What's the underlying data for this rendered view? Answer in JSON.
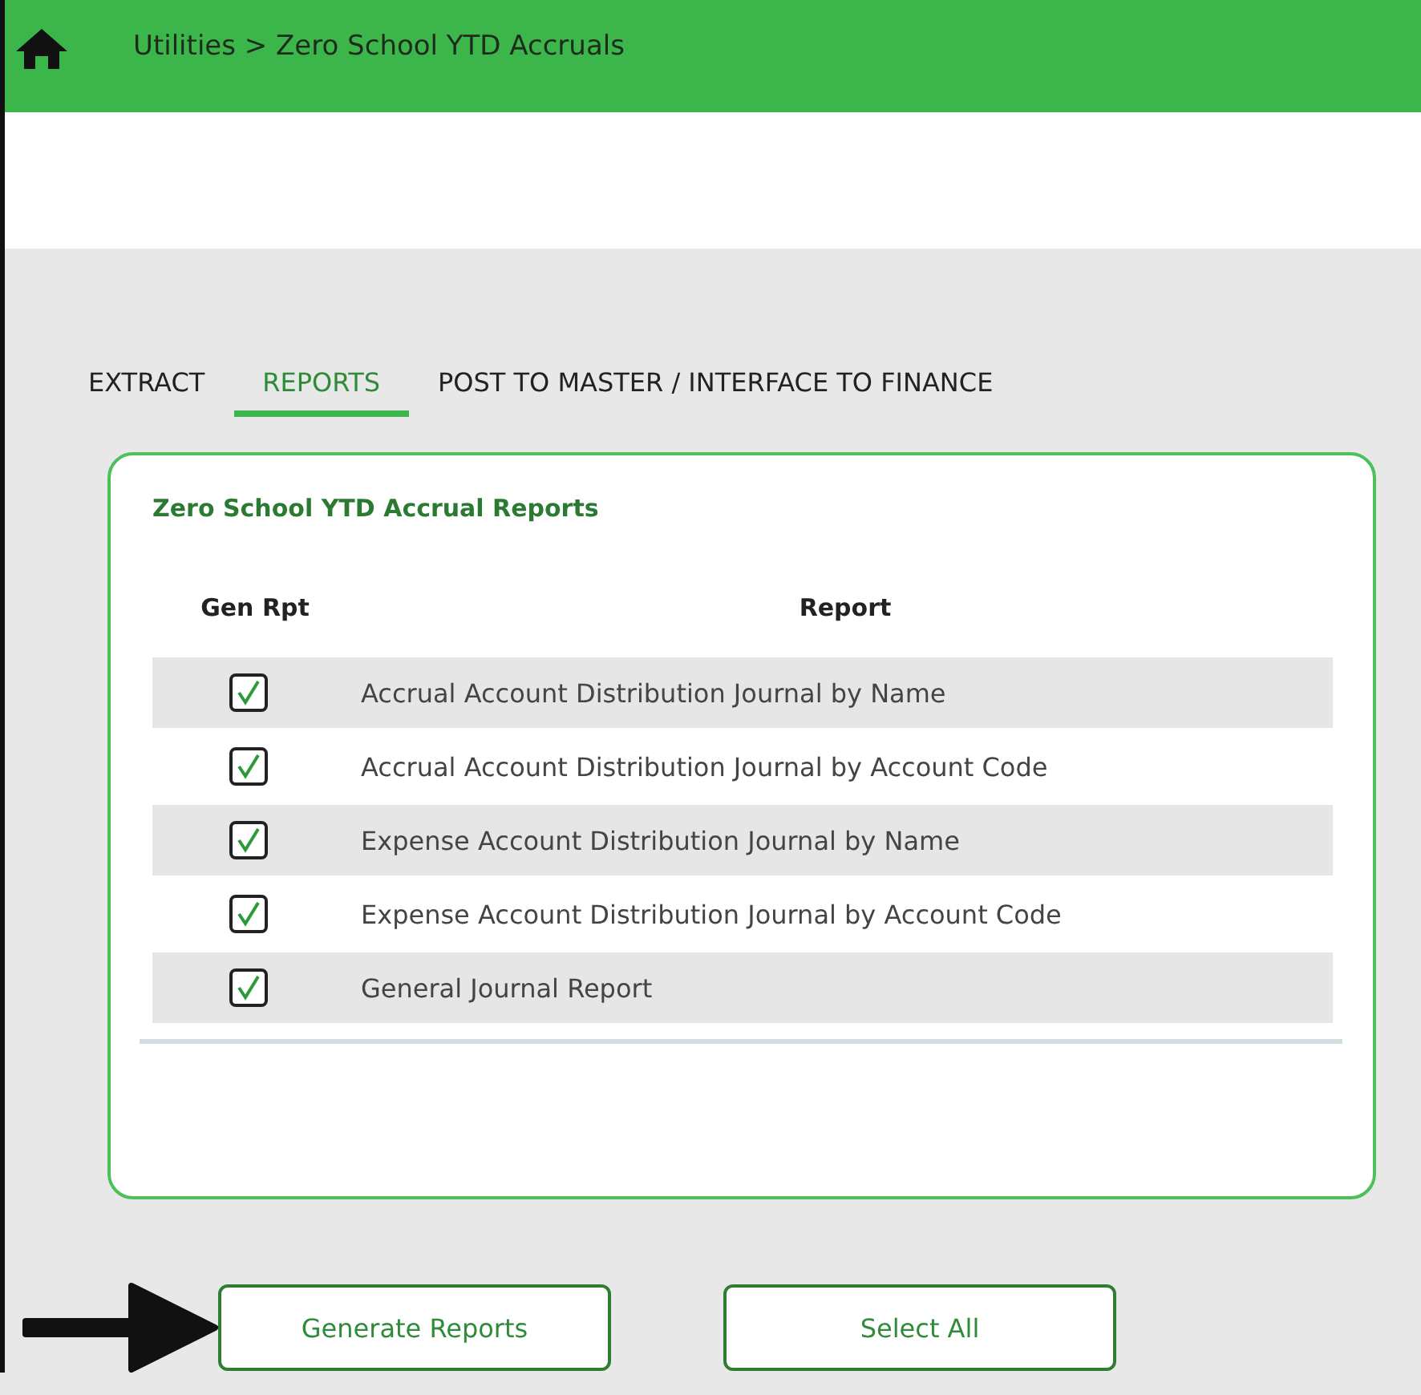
{
  "header": {
    "breadcrumb": "Utilities > Zero School YTD Accruals"
  },
  "tabs": [
    {
      "label": "EXTRACT",
      "selected": false
    },
    {
      "label": "REPORTS",
      "selected": true
    },
    {
      "label": "POST TO MASTER / INTERFACE TO FINANCE",
      "selected": false
    }
  ],
  "panel": {
    "title": "Zero School YTD Accrual Reports",
    "columns": [
      "Gen Rpt",
      "Report"
    ],
    "rows": [
      {
        "checked": true,
        "report": "Accrual Account Distribution Journal by Name"
      },
      {
        "checked": true,
        "report": "Accrual Account Distribution Journal by Account Code"
      },
      {
        "checked": true,
        "report": "Expense Account Distribution Journal by Name"
      },
      {
        "checked": true,
        "report": "Expense Account Distribution Journal by Account Code"
      },
      {
        "checked": true,
        "report": "General Journal Report"
      }
    ]
  },
  "buttons": [
    "Generate Reports",
    "Select All"
  ]
}
